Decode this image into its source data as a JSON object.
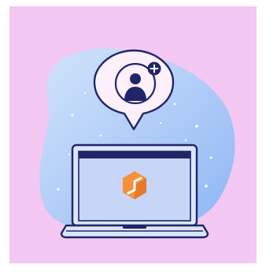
{
  "colors": {
    "frame": "#ffffff",
    "background": "#f3c8f2",
    "blob_light": "#d3e4fb",
    "blob_dark": "#8fb6f4",
    "outline": "#1f2668",
    "bubble_fill": "#fdf0fb",
    "laptop_body": "#dce6fb",
    "screen": "#c7d6f7",
    "screen_bar": "#1f2668",
    "logo_orange": "#f5913a",
    "logo_dark_orange": "#d9661f",
    "sparkle": "#ffffff",
    "plus_badge": "#1f2668",
    "plus_sign": "#ffffff"
  },
  "icons": {
    "bubble": "add-user-icon",
    "badge": "plus-icon",
    "screen_logo": "cube-logo-icon",
    "device": "laptop-icon"
  }
}
